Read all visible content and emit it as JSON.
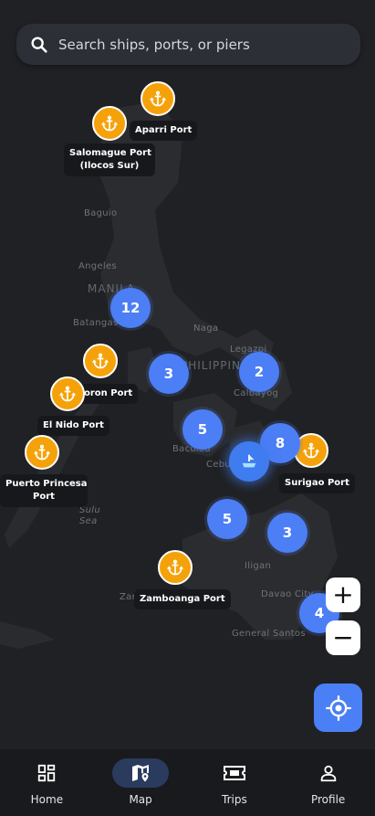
{
  "search": {
    "placeholder": "Search ships, ports, or piers"
  },
  "map_labels": {
    "baguio": "Baguio",
    "angeles": "Angeles",
    "manila": "MANILA",
    "batangas": "Batangas",
    "naga": "Naga",
    "legazpi": "Legazpi",
    "philippines": "PHILIPPINES",
    "calbayog": "Calbayog",
    "bacolod": "Bacolod",
    "cebu": "Cebu",
    "iligan": "Iligan",
    "davao_city": "Davao City",
    "general_santos": "General Santos",
    "zamboanga": "Zam",
    "sulu_sea": "Sulu\nSea"
  },
  "ports": [
    {
      "name": "Aparri Port"
    },
    {
      "name": "Salomague Port (Ilocos Sur)",
      "line1": "Salomague Port",
      "line2": "(Ilocos Sur)"
    },
    {
      "name": "Coron Port",
      "display": "oron Port"
    },
    {
      "name": "El Nido Port"
    },
    {
      "name": "Puerto Princesa Port",
      "line1": "Puerto Princesa",
      "line2": "Port"
    },
    {
      "name": "Surigao Port"
    },
    {
      "name": "Zamboanga Port"
    }
  ],
  "clusters": [
    {
      "count": "12"
    },
    {
      "count": "3"
    },
    {
      "count": "2"
    },
    {
      "count": "5"
    },
    {
      "count": "8"
    },
    {
      "count": "5"
    },
    {
      "count": "3"
    },
    {
      "count": "4"
    }
  ],
  "controls": {
    "zoom_in": "+",
    "zoom_out": "−"
  },
  "nav": [
    {
      "label": "Home",
      "icon": "dashboard-icon"
    },
    {
      "label": "Map",
      "icon": "map-pin-icon",
      "active": true
    },
    {
      "label": "Trips",
      "icon": "ticket-icon"
    },
    {
      "label": "Profile",
      "icon": "person-icon"
    }
  ],
  "colors": {
    "map_bg": "#202124",
    "land": "#2b2c2f",
    "port_pin": "#f5a20a",
    "cluster": "#4c7ef6",
    "nav_active": "#2b3b5e"
  }
}
